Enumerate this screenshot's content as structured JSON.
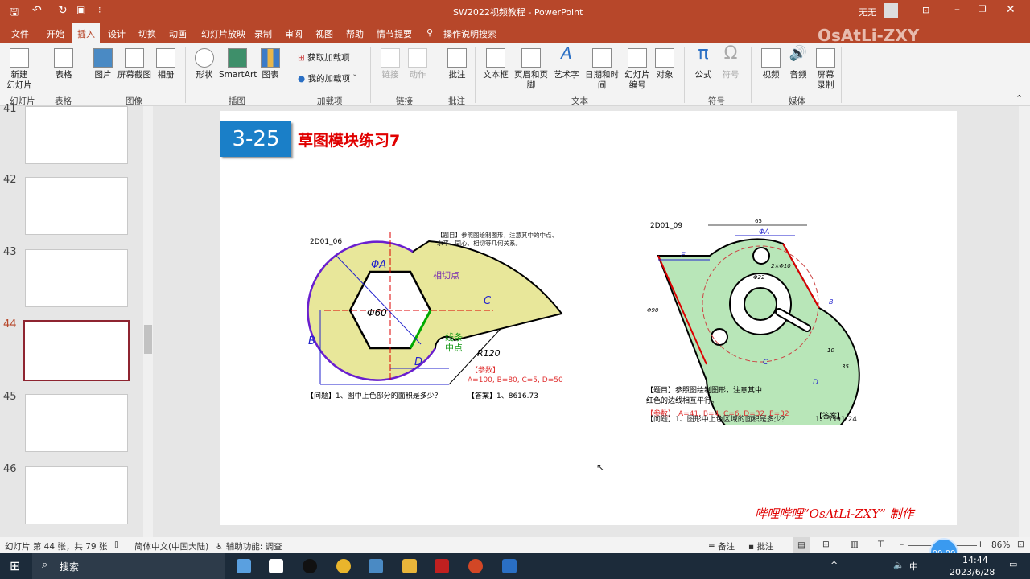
{
  "window": {
    "title": "SW2022视频教程 - PowerPoint",
    "user": "无无",
    "watermark": "OsAtLi-ZXY"
  },
  "tabs": [
    "文件",
    "开始",
    "插入",
    "设计",
    "切换",
    "动画",
    "幻灯片放映",
    "录制",
    "审阅",
    "视图",
    "帮助",
    "情节提要"
  ],
  "active_tab": "插入",
  "tell_me": "操作说明搜索",
  "ribbon": {
    "buttons": {
      "new_slide": "新建\n幻灯片",
      "table": "表格",
      "picture": "图片",
      "screenshot": "屏幕截图",
      "album": "相册",
      "shapes": "形状",
      "smartart": "SmartArt",
      "chart": "图表",
      "get_addins": "获取加载项",
      "my_addins": "我的加载项",
      "link": "链接",
      "action": "动作",
      "comment": "批注",
      "textbox": "文本框",
      "header_footer": "页眉和页脚",
      "wordart": "艺术字",
      "datetime": "日期和时间",
      "slide_number": "幻灯片编号",
      "object": "对象",
      "equation": "公式",
      "symbol": "符号",
      "video": "视频",
      "audio": "音频",
      "screen_record": "屏幕录制"
    },
    "groups": [
      "幻灯片",
      "表格",
      "图像",
      "插图",
      "加载项",
      "链接",
      "批注",
      "文本",
      "符号",
      "媒体"
    ]
  },
  "thumbnails": [
    {
      "num": "41"
    },
    {
      "num": "42"
    },
    {
      "num": "43"
    },
    {
      "num": "44",
      "selected": true
    },
    {
      "num": "45"
    },
    {
      "num": "46"
    }
  ],
  "slide": {
    "badge": "3-25",
    "title": "草图模块练习7",
    "left": {
      "id": "2D01_06",
      "prompt": "【题目】参照图绘制图形，注意其中的中点、水平、同心、相切等几何关系。",
      "tangent": "相切点",
      "midpoint1": "线条",
      "midpoint2": "中点",
      "dims": {
        "a": "ΦA",
        "d60": "Φ60",
        "b": "B",
        "c": "C",
        "d": "D",
        "r": "R120"
      },
      "param_label": "【参数】",
      "params": "A=100, B=80, C=5, D=50",
      "question": "【问题】1、图中上色部分的面积是多少？",
      "answer": "【答案】1、8616.73"
    },
    "right": {
      "id": "2D01_09",
      "prompt1": "【题目】参照图绘制图形，注意其中",
      "prompt2": "红色的边线相互平行。",
      "param_label": "【参数】",
      "params": "A=41, B=4, C=6, D=32, E=32",
      "answer_label": "【答案】",
      "question": "【问题】1、图形中上色区域的面积是多少？",
      "answer": "1、5391.24",
      "dims": {
        "w65": "65",
        "a": "ΦA",
        "e": "E",
        "d22": "Φ22",
        "d90": "Φ90",
        "b": "B",
        "c": "C",
        "d": "D",
        "n10": "10",
        "n35": "35",
        "holes": "2×Φ10"
      }
    },
    "footer": "哔哩哔哩“OsAtLi-ZXY” 制作"
  },
  "statusbar": {
    "slide_info": "幻灯片 第 44 张，共 79 张",
    "language": "简体中文(中国大陆)",
    "accessibility": "辅助功能: 调查",
    "notes": "备注",
    "comments": "批注",
    "zoom": "86%",
    "timer": "00:00"
  },
  "taskbar": {
    "search": "搜索",
    "time": "14:44",
    "date": "2023/6/28",
    "ime": "中"
  },
  "colors": {
    "accent": "#b7472a",
    "badge": "#1a7fc8",
    "title_red": "#e00000",
    "fill_yellow": "#e8e79a",
    "fill_green": "#b8e6b8"
  }
}
